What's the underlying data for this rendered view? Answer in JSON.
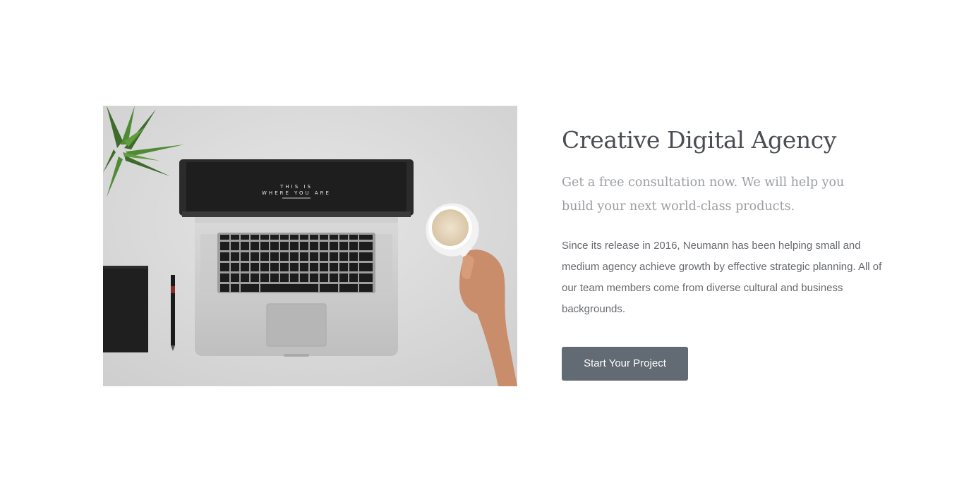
{
  "hero": {
    "image_alt": "Laptop on a desk with a coffee cup, plant, notebook and pen",
    "screen_text_line1": "THIS IS",
    "screen_text_line2": "WHERE YOU ARE"
  },
  "content": {
    "title": "Creative Digital Agency",
    "subtitle": "Get a free consultation now. We will help you build your next world-class products.",
    "body": "Since its release in 2016, Neumann has been helping small and medium agency achieve growth by effective strategic planning. All of our team members come from diverse cultural and business backgrounds.",
    "cta_label": "Start Your Project"
  },
  "colors": {
    "page_background": "#ffffff",
    "title": "#4a4d52",
    "subtitle": "#9b9ea3",
    "body": "#66696e",
    "button_background": "#626a73",
    "button_text": "#ffffff"
  }
}
